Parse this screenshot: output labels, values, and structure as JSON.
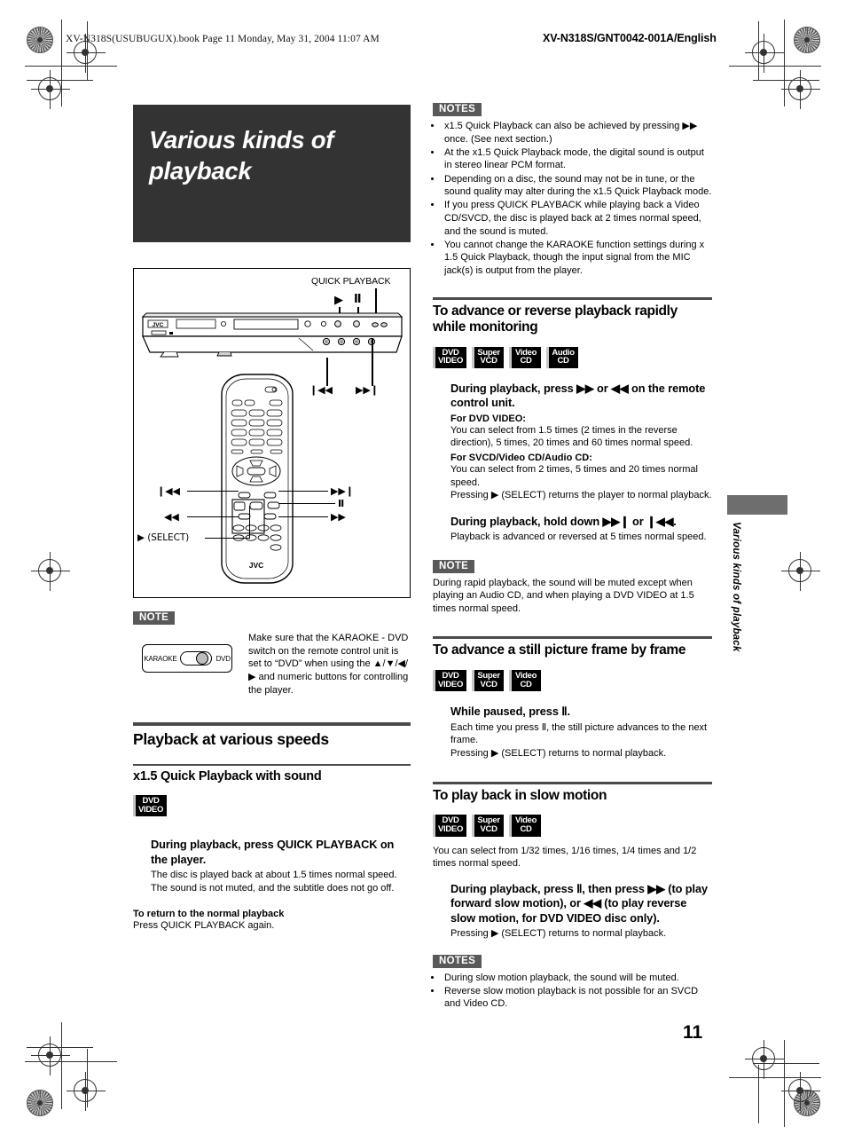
{
  "header": {
    "file_line": "XV-N318S(USUBUGUX).book  Page 11  Monday, May 31, 2004  11:07 AM",
    "doc_header": "XV-N318S/GNT0042-001A/English"
  },
  "page_number": "11",
  "side_tab": {
    "label": "Various kinds of playback"
  },
  "chapter": {
    "title": "Various kinds of playback"
  },
  "illustration": {
    "quick_playback_label": "QUICK PLAYBACK",
    "player_brand": "JVC",
    "player_play_label": "▶",
    "player_pause_label": "Ⅱ",
    "player_prev_label": "❙◀◀",
    "player_next_label": "▶▶❙",
    "remote_brand": "JVC",
    "remote_prev_label": "❙◀◀",
    "remote_next_label": "▶▶❙",
    "remote_rew_label": "◀◀",
    "remote_ff_label": "▶▶",
    "remote_pause_label": "Ⅱ",
    "remote_select_label": "▶ (SELECT)"
  },
  "left_note": {
    "tag": "NOTE",
    "switch_left": "KARAOKE",
    "switch_right": "DVD",
    "text": "Make sure that the KARAOKE - DVD switch on the remote control unit is set to “DVD” when using the ▲/▼/◀/▶ and numeric buttons for controlling the player."
  },
  "section_playback_speeds": {
    "heading": "Playback at various speeds",
    "sub_heading": "x1.5 Quick Playback with sound",
    "badges": [
      {
        "line1": "DVD",
        "line2": "VIDEO"
      }
    ],
    "instr_head": "During playback, press QUICK PLAYBACK on the player.",
    "instr_body_1": "The disc is played back at about 1.5 times normal speed.",
    "instr_body_2": "The sound is not muted, and the subtitle does not go off.",
    "return_head": "To return to the normal playback",
    "return_body": "Press QUICK PLAYBACK again."
  },
  "notes_top": {
    "tag": "NOTES",
    "items": [
      "x1.5 Quick Playback can also be achieved by pressing ▶▶ once. (See next section.)",
      "At the x1.5 Quick Playback mode, the digital sound is output in stereo linear PCM format.",
      "Depending on a disc, the sound may not be in tune, or the sound quality may alter during the x1.5 Quick Playback mode.",
      "If you press QUICK PLAYBACK while playing back a Video CD/SVCD, the disc is played back at 2 times normal speed, and the sound is muted.",
      "You cannot change the KARAOKE function settings during x 1.5 Quick Playback, though the input signal from the MIC jack(s) is output from the player."
    ]
  },
  "section_rapid": {
    "heading": "To advance or reverse playback rapidly while monitoring",
    "badges": [
      {
        "line1": "DVD",
        "line2": "VIDEO"
      },
      {
        "line1": "Super",
        "line2": "VCD"
      },
      {
        "line1": "Video",
        "line2": "CD"
      },
      {
        "line1": "Audio",
        "line2": "CD"
      }
    ],
    "instr1_head": "During playback, press ▶▶ or ◀◀ on the remote control unit.",
    "label_dvd": "For DVD VIDEO:",
    "body_dvd": "You can select from 1.5 times (2 times in the reverse direction), 5 times, 20 times and 60 times normal speed.",
    "label_svcd": "For SVCD/Video CD/Audio CD:",
    "body_svcd": "You can select from 2 times, 5 times and 20 times normal speed.",
    "body_select": "Pressing ▶ (SELECT) returns the player to normal playback.",
    "instr2_head": "During playback, hold down ▶▶❙ or ❙◀◀.",
    "instr2_body": "Playback is advanced or reversed at 5 times normal speed.",
    "note_tag": "NOTE",
    "note_body": "During rapid playback, the sound will be muted except when playing an Audio CD, and when playing a DVD VIDEO at 1.5 times normal speed."
  },
  "section_frame": {
    "heading": "To advance a still picture frame by frame",
    "badges": [
      {
        "line1": "DVD",
        "line2": "VIDEO"
      },
      {
        "line1": "Super",
        "line2": "VCD"
      },
      {
        "line1": "Video",
        "line2": "CD"
      }
    ],
    "instr_head": "While paused, press Ⅱ.",
    "instr_body_1": "Each time you press Ⅱ, the still picture advances to the next frame.",
    "instr_body_2": "Pressing ▶ (SELECT) returns to normal playback."
  },
  "section_slow": {
    "heading": "To play back in slow motion",
    "badges": [
      {
        "line1": "DVD",
        "line2": "VIDEO"
      },
      {
        "line1": "Super",
        "line2": "VCD"
      },
      {
        "line1": "Video",
        "line2": "CD"
      }
    ],
    "pretext": "You can select from 1/32 times, 1/16 times, 1/4 times and 1/2 times normal speed.",
    "instr_head": "During playback, press Ⅱ, then press ▶▶ (to play forward slow motion), or ◀◀ (to play reverse slow motion, for DVD VIDEO disc only).",
    "instr_body": "Pressing ▶ (SELECT) returns to normal playback.",
    "notes_tag": "NOTES",
    "notes_items": [
      "During slow motion playback, the sound will be muted.",
      "Reverse slow motion playback is not possible for an SVCD and Video CD."
    ]
  },
  "colors": {
    "chapter_bg": "#333333",
    "rule": "#4a4a4a",
    "tag_bg": "#595959",
    "side_tab": "#6e6e6e"
  }
}
